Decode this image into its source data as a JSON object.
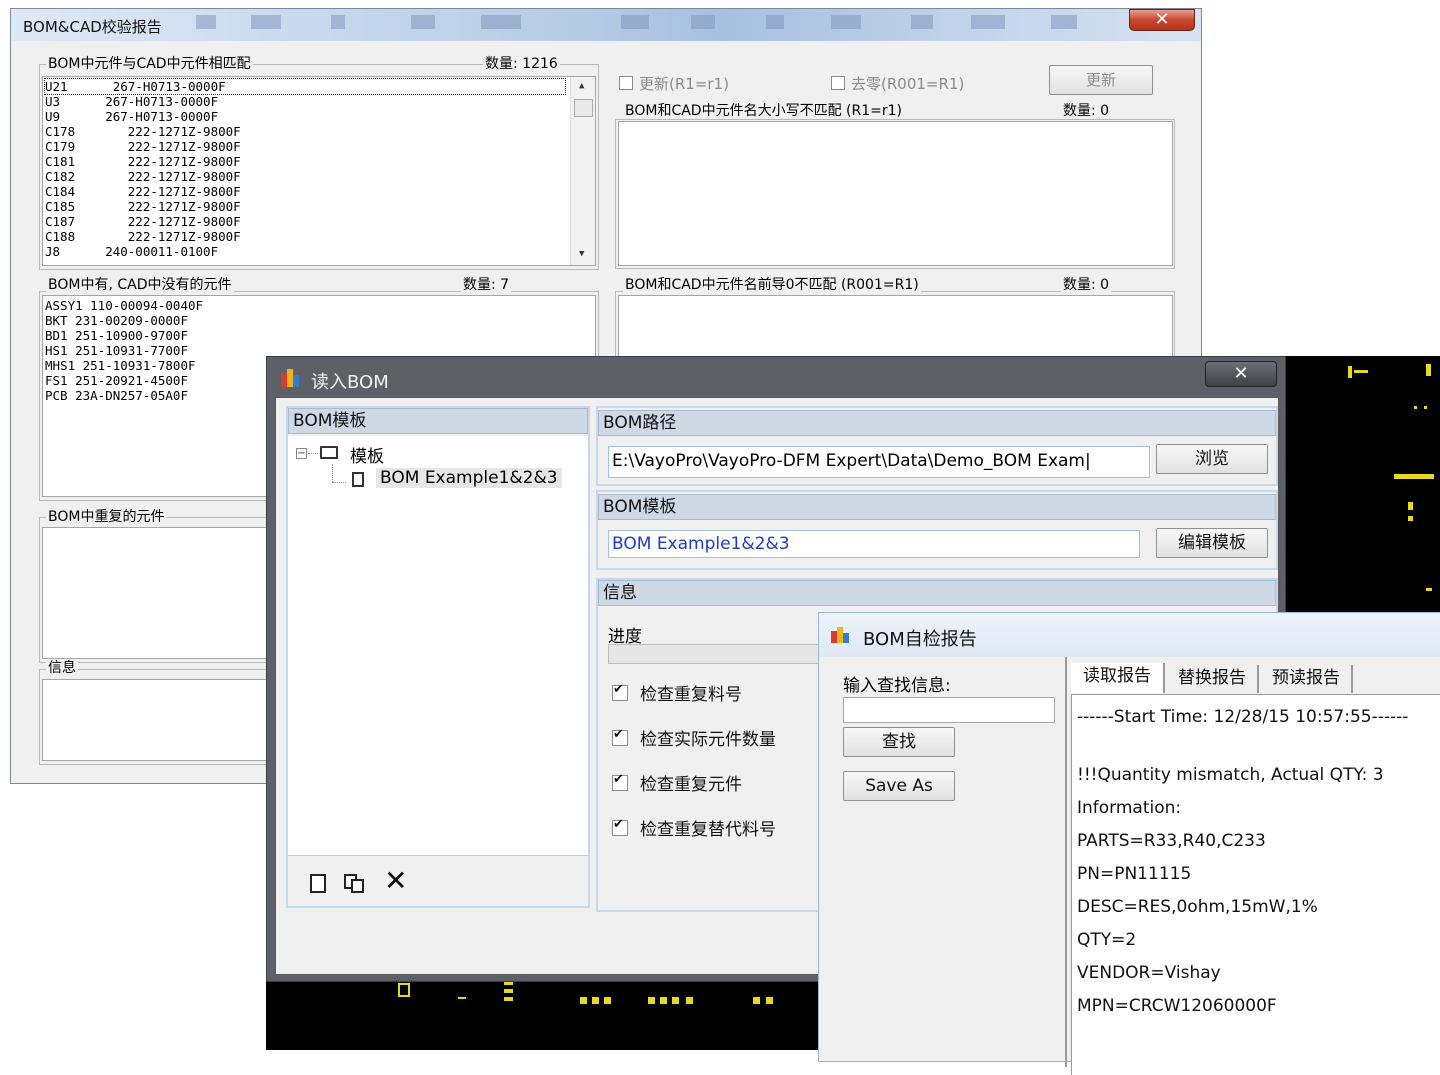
{
  "report_window": {
    "title": "BOM&CAD校验报告",
    "close_label": "✕",
    "matched": {
      "label": "BOM中元件与CAD中元件相匹配",
      "count_label": "数量: 1216",
      "rows": [
        "U21      267-H0713-0000F",
        "U3      267-H0713-0000F",
        "U9      267-H0713-0000F",
        "C178       222-1271Z-9800F",
        "C179       222-1271Z-9800F",
        "C181       222-1271Z-9800F",
        "C182       222-1271Z-9800F",
        "C184       222-1271Z-9800F",
        "C185       222-1271Z-9800F",
        "C187       222-1271Z-9800F",
        "C188       222-1271Z-9800F",
        "J8      240-00011-0100F"
      ]
    },
    "update_r1": "更新(R1=r1)",
    "remove_zero": "去零(R001=R1)",
    "update_button": "更新",
    "case_mismatch": {
      "label": "BOM和CAD中元件名大小写不匹配 (R1=r1)",
      "count_label": "数量: 0"
    },
    "bom_only": {
      "label": "BOM中有, CAD中没有的元件",
      "count_label": "数量: 7",
      "rows": [
        "ASSY1 110-00094-0040F",
        "BKT 231-00209-0000F",
        "BD1 251-10900-9700F",
        "HS1 251-10931-7700F",
        "MHS1 251-10931-7800F",
        "FS1 251-20921-4500F",
        "PCB 23A-DN257-05A0F"
      ]
    },
    "zero_mismatch": {
      "label": "BOM和CAD中元件名前导0不匹配 (R001=R1)",
      "count_label": "数量: 0"
    },
    "duplicates": {
      "label": "BOM中重复的元件"
    },
    "info": {
      "label": "信息"
    }
  },
  "read_bom_window": {
    "title": "读入BOM",
    "close_label": "✕",
    "tree_header": "BOM模板",
    "tree_root": "模板",
    "tree_child": "BOM Example1&2&3",
    "path_header": "BOM路径",
    "path_value": "E:\\VayoPro\\VayoPro-DFM Expert\\Data\\Demo_BOM Exam|",
    "browse_button": "浏览",
    "template_header": "BOM模板",
    "template_value": "BOM Example1&2&3",
    "edit_template_button": "编辑模板",
    "info_header": "信息",
    "progress_label": "进度",
    "progress": 0,
    "checks": [
      {
        "label": "检查重复料号",
        "checked": true
      },
      {
        "label": "检查实际元件数量",
        "checked": true
      },
      {
        "label": "检查重复元件",
        "checked": true
      },
      {
        "label": "检查重复替代料号",
        "checked": true
      }
    ],
    "tool_icons": [
      "new-file-icon",
      "copy-icon",
      "delete-icon"
    ]
  },
  "self_check_window": {
    "title": "BOM自检报告",
    "search_label": "输入查找信息:",
    "search_value": "",
    "find_button": "查找",
    "save_button": "Save As",
    "tabs": [
      "读取报告",
      "替换报告",
      "预读报告"
    ],
    "report_lines": [
      "------Start Time: 12/28/15 10:57:55------",
      "",
      "!!!Quantity mismatch, Actual QTY: 3",
      "Information:",
      " PARTS=R33,R40,C233",
      " PN=PN11115",
      " DESC=RES,0ohm,15mW,1%",
      " QTY=2",
      " VENDOR=Vishay",
      " MPN=CRCW12060000F"
    ]
  },
  "colors": {
    "pcb_background": "#000000",
    "pcb_pad": "#e8d81e",
    "link_blue": "#1f3ad6",
    "header_blue": "#cfd9e6"
  }
}
